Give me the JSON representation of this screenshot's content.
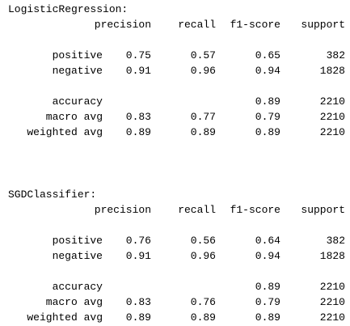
{
  "reports": [
    {
      "title": "LogisticRegression:",
      "headers": [
        "precision",
        "recall",
        "f1-score",
        "support"
      ],
      "rows": [
        {
          "label": "positive",
          "precision": "0.75",
          "recall": "0.57",
          "f1": "0.65",
          "support": "382"
        },
        {
          "label": "negative",
          "precision": "0.91",
          "recall": "0.96",
          "f1": "0.94",
          "support": "1828"
        },
        {
          "label": "accuracy",
          "precision": "",
          "recall": "",
          "f1": "0.89",
          "support": "2210"
        },
        {
          "label": "macro avg",
          "precision": "0.83",
          "recall": "0.77",
          "f1": "0.79",
          "support": "2210"
        },
        {
          "label": "weighted avg",
          "precision": "0.89",
          "recall": "0.89",
          "f1": "0.89",
          "support": "2210"
        }
      ]
    },
    {
      "title": "SGDClassifier:",
      "headers": [
        "precision",
        "recall",
        "f1-score",
        "support"
      ],
      "rows": [
        {
          "label": "positive",
          "precision": "0.76",
          "recall": "0.56",
          "f1": "0.64",
          "support": "382"
        },
        {
          "label": "negative",
          "precision": "0.91",
          "recall": "0.96",
          "f1": "0.94",
          "support": "1828"
        },
        {
          "label": "accuracy",
          "precision": "",
          "recall": "",
          "f1": "0.89",
          "support": "2210"
        },
        {
          "label": "macro avg",
          "precision": "0.83",
          "recall": "0.76",
          "f1": "0.79",
          "support": "2210"
        },
        {
          "label": "weighted avg",
          "precision": "0.89",
          "recall": "0.89",
          "f1": "0.89",
          "support": "2210"
        }
      ]
    }
  ]
}
